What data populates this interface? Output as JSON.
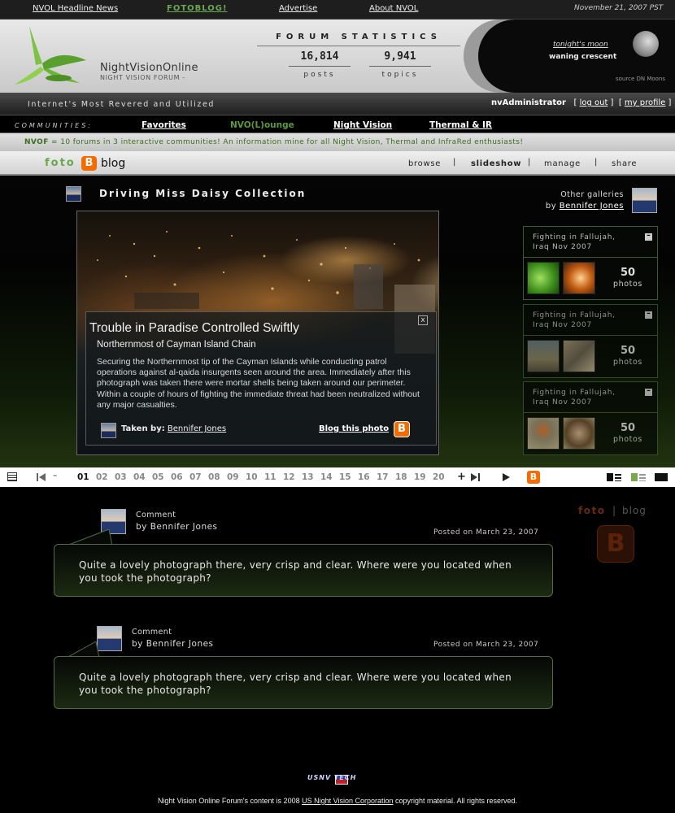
{
  "topnav": {
    "items": [
      "NVOL Headline News",
      "FOTOBLOG!",
      "Advertise",
      "About NVOL"
    ],
    "date": "November 21, 2007 PST"
  },
  "header": {
    "logo_title": "NightVisionOnline",
    "logo_subtitle": "NIGHT VISION FORUM -",
    "forum_stats_title": "FORUM STATISTICS",
    "posts_value": "16,814",
    "posts_label": "posts",
    "topics_value": "9,941",
    "topics_label": "topics",
    "moon_label": "tonight's moon",
    "moon_phase": "waning crescent",
    "moon_source": "source DN Moons"
  },
  "tagbar": {
    "tagline": "Internet's Most Revered and Utilized",
    "username": "nvAdministrator",
    "logout": "log out",
    "profile": "my profile"
  },
  "communities": {
    "label": "COMMUNITIES:",
    "items": [
      "Favorites",
      "NVO(L)ounge",
      "Night Vision",
      "Thermal & IR"
    ]
  },
  "info_bar": {
    "prefix": "NVOF",
    "text": " = 10 forums in 3 interactive communities! An information mine for all Night Vision, Thermal and InfraRed enthusiasts!"
  },
  "fotoblog_bar": {
    "foto": "foto",
    "icon": "B",
    "blog": "blog",
    "nav": [
      "browse",
      "slideshow",
      "manage",
      "share"
    ],
    "active": "slideshow"
  },
  "gallery": {
    "title": "Driving Miss Daisy Collection",
    "other_label": "Other galleries",
    "other_by_prefix": "by ",
    "other_by_name": "Bennifer Jones"
  },
  "caption": {
    "close_icon": "x",
    "title": "Trouble in Paradise Controlled Swiftly",
    "subtitle": "Northernmost of Cayman Island Chain",
    "body": "Securing the Northernmost tip of the Cayman Islands while conducting patrol operations against al-qaida insurgents seen around the area. Immediately after this photograph was taken there were mortar shells being taken around our perimeter. Within a couple of hours of fighting the immediate threat had been neutralized without any major casualties.",
    "taken_by_label": "Taken by:",
    "taken_by_name": "Bennifer Jones",
    "blog_this": "Blog this photo"
  },
  "cards": [
    {
      "title": "Fighting in Fallujah, Iraq Nov 2007",
      "count": "50",
      "label": "photos",
      "active": true
    },
    {
      "title": "Fighting in Fallujah, Iraq Nov 2007",
      "count": "50",
      "label": "photos",
      "active": false
    },
    {
      "title": "Fighting in Fallujah, Iraq Nov 2007",
      "count": "50",
      "label": "photos",
      "active": false
    }
  ],
  "toolbar": {
    "minus": "–",
    "plus": "+",
    "pages": [
      "01",
      "02",
      "03",
      "04",
      "05",
      "06",
      "07",
      "08",
      "09",
      "10",
      "11",
      "12",
      "13",
      "14",
      "15",
      "16",
      "17",
      "18",
      "19",
      "20"
    ],
    "current_page": "01"
  },
  "sidebar": {
    "foto": "foto",
    "sep": "|",
    "blog": "blog",
    "icon": "B"
  },
  "comments": [
    {
      "label": "Comment",
      "by": "by Bennifer Jones",
      "date": "Posted on March 23, 2007",
      "text": "Quite a lovely photograph there, very crisp and clear. Where were you located when you took the photograph?"
    },
    {
      "label": "Comment",
      "by": "by Bennifer Jones",
      "date": "Posted on March 23, 2007",
      "text": "Quite a lovely photograph there, very crisp and clear. Where were you located when you took the photograph?"
    }
  ],
  "footer": {
    "logo_text": "USNV TECH",
    "text_prefix": "Night Vision Online Forum's content is 2008 ",
    "company": "US Night Vision Corporation",
    "text_suffix": " copyright material. All rights reserved."
  },
  "colors": {
    "accent_green": "#6aa84f",
    "blogger_orange": "#f26c00"
  }
}
